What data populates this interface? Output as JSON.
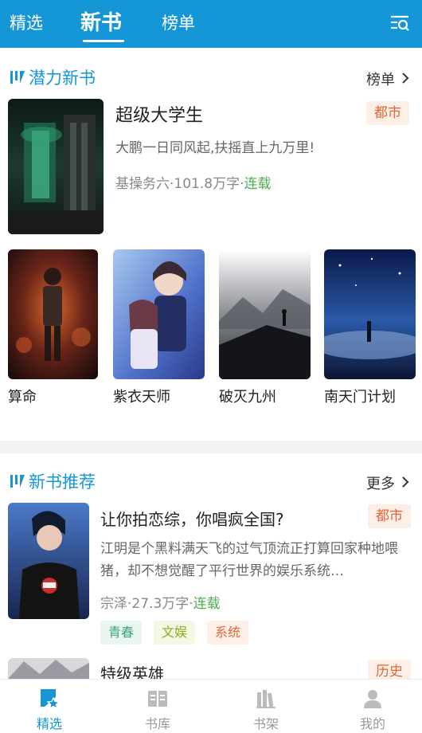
{
  "header": {
    "tabs": [
      {
        "label": "精选",
        "active": false
      },
      {
        "label": "新书",
        "active": true
      },
      {
        "label": "榜单",
        "active": false
      }
    ],
    "search_icon": "search-list-icon"
  },
  "potential": {
    "title": "潜力新书",
    "more": "榜单",
    "featured": {
      "title": "超级大学生",
      "genre": "都市",
      "desc": "大鹏一日同风起,扶摇直上九万里!",
      "author": "基操务六",
      "words": "101.8万字",
      "status": "连载"
    },
    "grid": [
      {
        "title": "算命"
      },
      {
        "title": "紫衣天师"
      },
      {
        "title": "破灭九州"
      },
      {
        "title": "南天门计划"
      }
    ]
  },
  "recommend": {
    "title": "新书推荐",
    "more": "更多",
    "books": [
      {
        "title": "让你拍恋综，你唱疯全国?",
        "genre": "都市",
        "desc": "江明是个黑料满天飞的过气顶流正打算回家种地喂猪，却不想觉醒了平行世界的娱乐系统…",
        "author": "宗泽",
        "words": "27.3万字",
        "status": "连载",
        "tags": [
          "青春",
          "文娱",
          "系统"
        ]
      },
      {
        "title": "特级英雄",
        "genre": "历史"
      }
    ]
  },
  "sep": "·",
  "nav": [
    {
      "label": "精选",
      "active": true
    },
    {
      "label": "书库",
      "active": false
    },
    {
      "label": "书架",
      "active": false
    },
    {
      "label": "我的",
      "active": false
    }
  ],
  "colors": {
    "brand": "#1596d6",
    "status_green": "#4caf50",
    "tag_orange": "#e0683a"
  }
}
